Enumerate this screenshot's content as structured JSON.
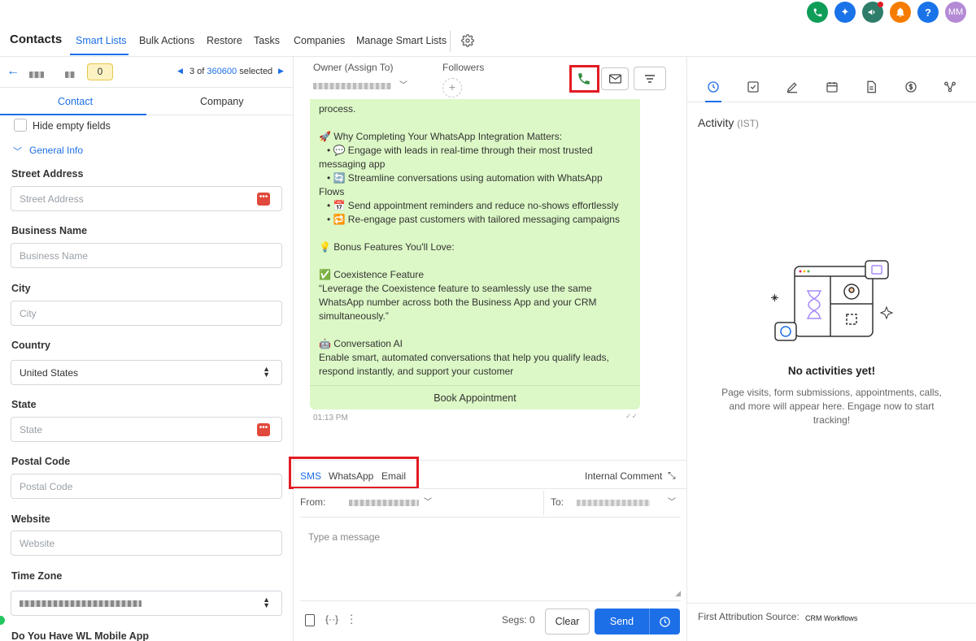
{
  "topbar": {
    "icons": [
      {
        "name": "phone-icon",
        "color": "#0f9d58"
      },
      {
        "name": "magic-icon",
        "color": "#1a73e8"
      },
      {
        "name": "megaphone-icon",
        "color": "#2e7d6b"
      },
      {
        "name": "bell-icon",
        "color": "#f57c00"
      },
      {
        "name": "help-icon",
        "color": "#1a73e8"
      }
    ],
    "avatar_initials": "MM",
    "avatar_color": "#b48ad6"
  },
  "nav": {
    "title": "Contacts",
    "tabs": [
      "Smart Lists",
      "Bulk Actions",
      "Restore",
      "Tasks",
      "Companies",
      "Manage Smart Lists"
    ],
    "active_tab": "Smart Lists"
  },
  "left": {
    "badge": "0",
    "pager": {
      "prefix": "3 of",
      "total": "360600",
      "suffix": "selected"
    },
    "tabs": [
      "Contact",
      "Company"
    ],
    "hide_empty": "Hide empty fields",
    "section": "General Info",
    "fields": [
      {
        "label": "Street Address",
        "placeholder": "Street Address",
        "has_menu": true
      },
      {
        "label": "Business Name",
        "placeholder": "Business Name",
        "has_menu": false
      },
      {
        "label": "City",
        "placeholder": "City",
        "has_menu": false
      },
      {
        "label": "Country",
        "value": "United States",
        "select": true
      },
      {
        "label": "State",
        "placeholder": "State",
        "has_menu": true
      },
      {
        "label": "Postal Code",
        "placeholder": "Postal Code",
        "has_menu": false
      },
      {
        "label": "Website",
        "placeholder": "Website",
        "has_menu": false
      },
      {
        "label": "Time Zone",
        "select": true
      }
    ],
    "cutoff_label": "Do You Have WL Mobile App"
  },
  "middle": {
    "owner_label": "Owner (Assign To)",
    "followers_label": "Followers",
    "message_lines": [
      {
        "text": "process.",
        "indent": false
      },
      {
        "text": "",
        "indent": false
      },
      {
        "text": "🚀 Why Completing Your WhatsApp Integration Matters:",
        "indent": false
      },
      {
        "text": "• 💬 Engage with leads in real-time through their most trusted",
        "indent": true
      },
      {
        "text": "messaging app",
        "indent": false
      },
      {
        "text": "• 🔄 Streamline conversations using automation with WhatsApp",
        "indent": true
      },
      {
        "text": "Flows",
        "indent": false
      },
      {
        "text": "• 📅 Send appointment reminders and reduce no-shows effortlessly",
        "indent": true
      },
      {
        "text": "• 🔁 Re-engage past customers with tailored messaging campaigns",
        "indent": true
      },
      {
        "text": "",
        "indent": false
      },
      {
        "text": "💡 Bonus Features You'll Love:",
        "indent": false
      },
      {
        "text": "",
        "indent": false
      },
      {
        "text": "✅ Coexistence Feature",
        "indent": false
      },
      {
        "text": "“Leverage the Coexistence feature to seamlessly use the same",
        "indent": false
      },
      {
        "text": "WhatsApp number across both the Business App and your CRM",
        "indent": false
      },
      {
        "text": "simultaneously.”",
        "indent": false
      },
      {
        "text": "",
        "indent": false
      },
      {
        "text": "🤖 Conversation AI",
        "indent": false
      },
      {
        "text": "Enable smart, automated conversations that help you qualify leads,",
        "indent": false
      },
      {
        "text": "respond instantly, and support your customer",
        "indent": false
      }
    ],
    "book_button": "Book Appointment",
    "timestamp": "01:13 PM",
    "channels": [
      "SMS",
      "WhatsApp",
      "Email"
    ],
    "active_channel": "SMS",
    "internal_comment": "Internal Comment",
    "from_label": "From:",
    "to_label": "To:",
    "message_placeholder": "Type a message",
    "segs": "Segs: 0",
    "clear_label": "Clear",
    "send_label": "Send",
    "accent": "#1d6fe8"
  },
  "right": {
    "activity_title": "Activity",
    "activity_tz": "(IST)",
    "empty_title": "No activities yet!",
    "empty_desc_lines": [
      "Page visits, form submissions, appointments, calls,",
      "and more will appear here. Engage now to start",
      "tracking!"
    ],
    "attribution_label": "First Attribution Source:",
    "attribution_value": "CRM Workflows",
    "tab_icons": [
      "clock-icon",
      "checkbox-icon",
      "pen-icon",
      "calendar-icon",
      "document-icon",
      "dollar-icon",
      "workflow-icon"
    ]
  }
}
